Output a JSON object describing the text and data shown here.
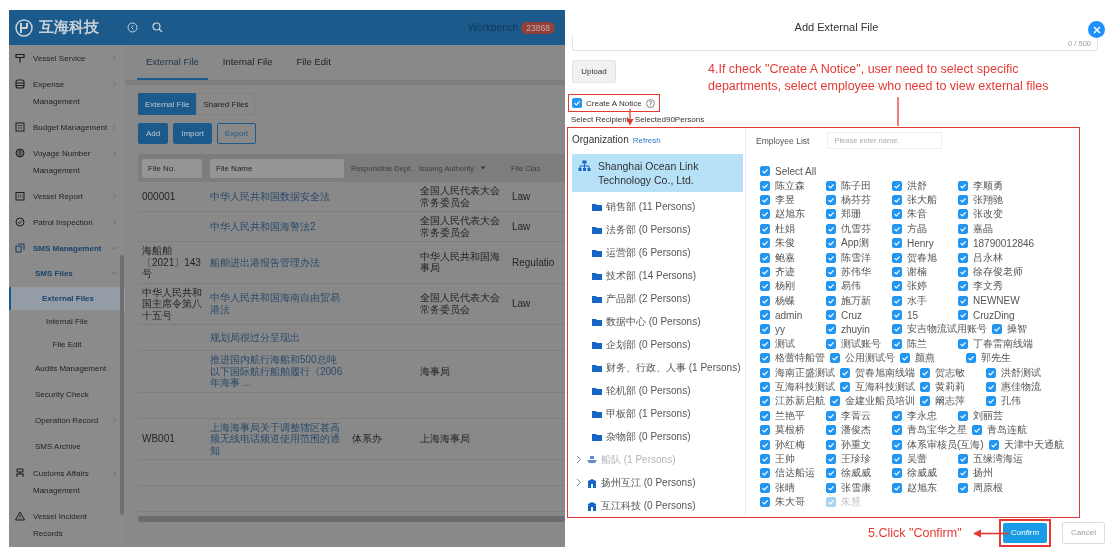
{
  "app": {
    "logo_text": "互海科技",
    "workbench": {
      "label": "Workbench",
      "badge": "23868"
    },
    "sidebar": [
      {
        "label": "Vessel Service",
        "selected": false,
        "highlighted": false,
        "expanded": false
      },
      {
        "label": "Expense Management",
        "selected": false,
        "highlighted": false,
        "expanded": false
      },
      {
        "label": "Budget Management",
        "selected": false,
        "highlighted": false,
        "expanded": false
      },
      {
        "label": "Voyage Number Management",
        "selected": false,
        "highlighted": false,
        "expanded": false
      },
      {
        "label": "Vessel Report",
        "selected": false,
        "highlighted": false,
        "expanded": false
      },
      {
        "label": "Patrol Inspection",
        "selected": false,
        "highlighted": false,
        "expanded": false
      },
      {
        "label": "SMS Management",
        "selected": false,
        "highlighted": true,
        "expanded": true,
        "children": [
          {
            "label": "SMS Files",
            "selected": false,
            "highlighted": true,
            "expanded": true,
            "children": [
              {
                "label": "External Files",
                "selected": true,
                "highlighted": false
              },
              {
                "label": "Internal File",
                "selected": false,
                "highlighted": false
              },
              {
                "label": "File Edit",
                "selected": false,
                "highlighted": false
              }
            ]
          },
          {
            "label": "Audits Management",
            "selected": false,
            "highlighted": false
          },
          {
            "label": "Security Check",
            "selected": false,
            "highlighted": false
          },
          {
            "label": "Operation Record",
            "selected": false,
            "highlighted": false,
            "expanded": false
          },
          {
            "label": "SMS Archive",
            "selected": false,
            "highlighted": false
          }
        ]
      },
      {
        "label": "Customs Affairs Management",
        "selected": false,
        "highlighted": false,
        "expanded": false
      },
      {
        "label": "Vessel Incident Records",
        "selected": false,
        "highlighted": false
      }
    ],
    "tabs": [
      {
        "label": "External File",
        "selected": true
      },
      {
        "label": "Internal File",
        "selected": false
      },
      {
        "label": "File Edit",
        "selected": false
      }
    ],
    "subtabs": [
      {
        "label": "External File",
        "selected": true
      },
      {
        "label": "Shared Files",
        "selected": false
      }
    ],
    "buttons": [
      {
        "label": "Add",
        "kind": "primary"
      },
      {
        "label": "Import",
        "kind": "primary"
      },
      {
        "label": "Export",
        "kind": "outline"
      }
    ],
    "table": {
      "columns": [
        {
          "placeholder": "File No.",
          "kind": "filter"
        },
        {
          "placeholder": "File Name",
          "kind": "filter"
        },
        {
          "label": "Responsible Dept.",
          "kind": "text"
        },
        {
          "label": "Issuing Authority",
          "kind": "dropdown"
        },
        {
          "label": "File Clas",
          "kind": "text"
        }
      ],
      "rows": [
        {
          "file_no": "000001",
          "file_name": "中华人民共和国数据安全法",
          "issuing_authority": "全国人民代表大会常务委员会",
          "file_class": "Law"
        },
        {
          "file_name": "中华人民共和国海警法2",
          "issuing_authority": "全国人民代表大会常务委员会",
          "file_class": "Law"
        },
        {
          "file_no": "海船舶〔2021〕143号",
          "file_name": "船舶进出港报告管理办法",
          "issuing_authority": "中华人民共和国海事局",
          "file_class": "Regulatio"
        },
        {
          "file_no": "中华人民共和国主席令第八十五号",
          "file_name": "中华人民共和国海南自由贸易港法",
          "issuing_authority": "全国人民代表大会常务委员会",
          "file_class": "Law"
        },
        {
          "file_name": "规划局很过分呈现出"
        },
        {
          "file_name": "推进国内航行海船和500总吨以下国际航行船舶履行《2006年海事 ...",
          "issuing_authority": "海事局"
        },
        {},
        {
          "file_no": "WB001",
          "file_name": "上海海事局关于调整辖区甚高频无线电话频道使用范围的通知",
          "responsible_dept": "体系办",
          "issuing_authority": "上海海事局"
        },
        {},
        {}
      ]
    }
  },
  "modal": {
    "title": "Add External File",
    "char_count": "0 / 500",
    "upload": "Upload",
    "create_notice": {
      "label": "Create A Notice",
      "checked": true
    },
    "select_recipient": "Select Recipient",
    "selected_count": "Selected90Persons",
    "organization": {
      "title": "Organization",
      "refresh": "Refresh",
      "tree": [
        {
          "label": "Shanghai Ocean Link Technology Co., Ltd.",
          "kind": "org",
          "selected": true,
          "disabled": false,
          "children": [
            {
              "label": "销售部 (11 Persons)",
              "kind": "department",
              "selected": false,
              "disabled": false
            },
            {
              "label": "法务部 (0 Persons)",
              "kind": "department",
              "selected": false,
              "disabled": false
            },
            {
              "label": "运营部 (6 Persons)",
              "kind": "department",
              "selected": false,
              "disabled": false
            },
            {
              "label": "技术部 (14 Persons)",
              "kind": "department",
              "selected": false,
              "disabled": false
            },
            {
              "label": "产品部 (2 Persons)",
              "kind": "department",
              "selected": false,
              "disabled": false
            },
            {
              "label": "数据中心 (0 Persons)",
              "kind": "department",
              "selected": false,
              "disabled": false
            },
            {
              "label": "企划部 (0 Persons)",
              "kind": "department",
              "selected": false,
              "disabled": false
            },
            {
              "label": "财务、行政、人事 (1 Persons)",
              "kind": "department",
              "selected": false,
              "disabled": false
            },
            {
              "label": "轮机部 (0 Persons)",
              "kind": "department",
              "selected": false,
              "disabled": false
            },
            {
              "label": "甲板部 (1 Persons)",
              "kind": "department",
              "selected": false,
              "disabled": false
            },
            {
              "label": "杂物部 (0 Persons)",
              "kind": "department",
              "selected": false,
              "disabled": false
            }
          ]
        },
        {
          "label": "船队 (1 Persons)",
          "kind": "fleet",
          "selected": false,
          "disabled": true,
          "expanded": false
        },
        {
          "label": "扬州互江 (0 Persons)",
          "kind": "branch",
          "selected": false,
          "disabled": false,
          "expanded": false
        },
        {
          "label": "互江科技 (0 Persons)",
          "kind": "branch",
          "selected": false,
          "disabled": false
        }
      ]
    },
    "employees": {
      "title": "Employee List",
      "search_placeholder": "Please enter name.",
      "select_all": {
        "label": "Select All",
        "checked": true
      },
      "list": [
        {
          "name": "陈立森",
          "checked": true,
          "disabled": false
        },
        {
          "name": "陈子田",
          "checked": true,
          "disabled": false
        },
        {
          "name": "洪舒",
          "checked": true,
          "disabled": false
        },
        {
          "name": "李顺勇",
          "checked": true,
          "disabled": false
        },
        {
          "name": "李昱",
          "checked": true,
          "disabled": false
        },
        {
          "name": "杨芬芬",
          "checked": true,
          "disabled": false
        },
        {
          "name": "张大船",
          "checked": true,
          "disabled": false
        },
        {
          "name": "张翔驰",
          "checked": true,
          "disabled": false
        },
        {
          "name": "赵旭东",
          "checked": true,
          "disabled": false
        },
        {
          "name": "郑珊",
          "checked": true,
          "disabled": false
        },
        {
          "name": "朱音",
          "checked": true,
          "disabled": false
        },
        {
          "name": "张改变",
          "checked": true,
          "disabled": false
        },
        {
          "name": "杜娟",
          "checked": true,
          "disabled": false
        },
        {
          "name": "仇雪芬",
          "checked": true,
          "disabled": false
        },
        {
          "name": "方晶",
          "checked": true,
          "disabled": false
        },
        {
          "name": "嘉晶",
          "checked": true,
          "disabled": false
        },
        {
          "name": "朱俊",
          "checked": true,
          "disabled": false
        },
        {
          "name": "App测",
          "checked": true,
          "disabled": false
        },
        {
          "name": "Henry",
          "checked": true,
          "disabled": false
        },
        {
          "name": "18790012846",
          "checked": true,
          "disabled": false
        },
        {
          "name": "鲍嘉",
          "checked": true,
          "disabled": false
        },
        {
          "name": "陈雪洋",
          "checked": true,
          "disabled": false
        },
        {
          "name": "贺春旭",
          "checked": true,
          "disabled": false
        },
        {
          "name": "吕永林",
          "checked": true,
          "disabled": false
        },
        {
          "name": "齐迹",
          "checked": true,
          "disabled": false
        },
        {
          "name": "苏伟华",
          "checked": true,
          "disabled": false
        },
        {
          "name": "谢楠",
          "checked": true,
          "disabled": false
        },
        {
          "name": "徐存俊老师",
          "checked": true,
          "disabled": false
        },
        {
          "name": "杨刚",
          "checked": true,
          "disabled": false
        },
        {
          "name": "易伟",
          "checked": true,
          "disabled": false
        },
        {
          "name": "张婷",
          "checked": true,
          "disabled": false
        },
        {
          "name": "李文秀",
          "checked": true,
          "disabled": false
        },
        {
          "name": "杨蝶",
          "checked": true,
          "disabled": false
        },
        {
          "name": "施万新",
          "checked": true,
          "disabled": false
        },
        {
          "name": "水手",
          "checked": true,
          "disabled": false
        },
        {
          "name": "NEWNEW",
          "checked": true,
          "disabled": false
        },
        {
          "name": "admin",
          "checked": true,
          "disabled": false
        },
        {
          "name": "Cruz",
          "checked": true,
          "disabled": false
        },
        {
          "name": "15",
          "checked": true,
          "disabled": false
        },
        {
          "name": "CruzDing",
          "checked": true,
          "disabled": false
        },
        {
          "name": "yy",
          "checked": true,
          "disabled": false
        },
        {
          "name": "zhuyin",
          "checked": true,
          "disabled": false
        },
        {
          "name": "安吉物流试用账号",
          "checked": true,
          "disabled": false
        },
        {
          "name": "操智",
          "checked": true,
          "disabled": false
        },
        {
          "name": "测试",
          "checked": true,
          "disabled": false
        },
        {
          "name": "测试账号",
          "checked": true,
          "disabled": false
        },
        {
          "name": "陈兰",
          "checked": true,
          "disabled": false
        },
        {
          "name": "丁春雷南线端",
          "checked": true,
          "disabled": false
        },
        {
          "name": "格蕾特船管",
          "checked": true,
          "disabled": false
        },
        {
          "name": "公用测试号",
          "checked": true,
          "disabled": false
        },
        {
          "name": "颜燕",
          "checked": true,
          "disabled": false
        },
        {
          "name": "郭先生",
          "checked": true,
          "disabled": false
        },
        {
          "name": "海南正盛测试",
          "checked": true,
          "disabled": false
        },
        {
          "name": "贺春旭南线端",
          "checked": true,
          "disabled": false
        },
        {
          "name": "贺志敏",
          "checked": true,
          "disabled": false
        },
        {
          "name": "洪舒测试",
          "checked": true,
          "disabled": false
        },
        {
          "name": "互海科技测试",
          "checked": true,
          "disabled": false
        },
        {
          "name": "互海科技测试",
          "checked": true,
          "disabled": false
        },
        {
          "name": "黄莉莉",
          "checked": true,
          "disabled": false
        },
        {
          "name": "惠佳物流",
          "checked": true,
          "disabled": false
        },
        {
          "name": "江苏新启航",
          "checked": true,
          "disabled": false
        },
        {
          "name": "金建业船员培训",
          "checked": true,
          "disabled": false
        },
        {
          "name": "阚志萍",
          "checked": true,
          "disabled": false
        },
        {
          "name": "孔伟",
          "checked": true,
          "disabled": false
        },
        {
          "name": "兰艳平",
          "checked": true,
          "disabled": false
        },
        {
          "name": "李菁云",
          "checked": true,
          "disabled": false
        },
        {
          "name": "李永忠",
          "checked": true,
          "disabled": false
        },
        {
          "name": "刘丽芸",
          "checked": true,
          "disabled": false
        },
        {
          "name": "莫根桥",
          "checked": true,
          "disabled": false
        },
        {
          "name": "潘俊杰",
          "checked": true,
          "disabled": false
        },
        {
          "name": "青岛宝华之星",
          "checked": true,
          "disabled": false
        },
        {
          "name": "青岛连航",
          "checked": true,
          "disabled": false
        },
        {
          "name": "孙红梅",
          "checked": true,
          "disabled": false
        },
        {
          "name": "孙重文",
          "checked": true,
          "disabled": false
        },
        {
          "name": "体系审核员(互海)",
          "checked": true,
          "disabled": false
        },
        {
          "name": "天津中天通航",
          "checked": true,
          "disabled": false
        },
        {
          "name": "王帅",
          "checked": true,
          "disabled": false
        },
        {
          "name": "王珍珍",
          "checked": true,
          "disabled": false
        },
        {
          "name": "吴蕾",
          "checked": true,
          "disabled": false
        },
        {
          "name": "五缘湾海运",
          "checked": true,
          "disabled": false
        },
        {
          "name": "信达船运",
          "checked": true,
          "disabled": false
        },
        {
          "name": "徐威威",
          "checked": true,
          "disabled": false
        },
        {
          "name": "徐威威",
          "checked": true,
          "disabled": false
        },
        {
          "name": "扬州",
          "checked": true,
          "disabled": false
        },
        {
          "name": "张晴",
          "checked": true,
          "disabled": false
        },
        {
          "name": "张雪康",
          "checked": true,
          "disabled": false
        },
        {
          "name": "赵旭东",
          "checked": true,
          "disabled": false
        },
        {
          "name": "周原根",
          "checked": true,
          "disabled": false
        },
        {
          "name": "朱大哥",
          "checked": true,
          "disabled": false
        },
        {
          "name": "朱慧",
          "checked": true,
          "disabled": true
        }
      ]
    },
    "buttons": [
      {
        "label": "Confirm",
        "kind": "primary"
      },
      {
        "label": "Cancel",
        "kind": "default"
      }
    ]
  },
  "annotations": [
    {
      "kind": "note",
      "text": "4.If check \"Create A Notice\", user need to select specific departments, select employee who need to view external files"
    },
    {
      "kind": "confirm_note",
      "text": "5.Click \"Confirm\""
    }
  ]
}
